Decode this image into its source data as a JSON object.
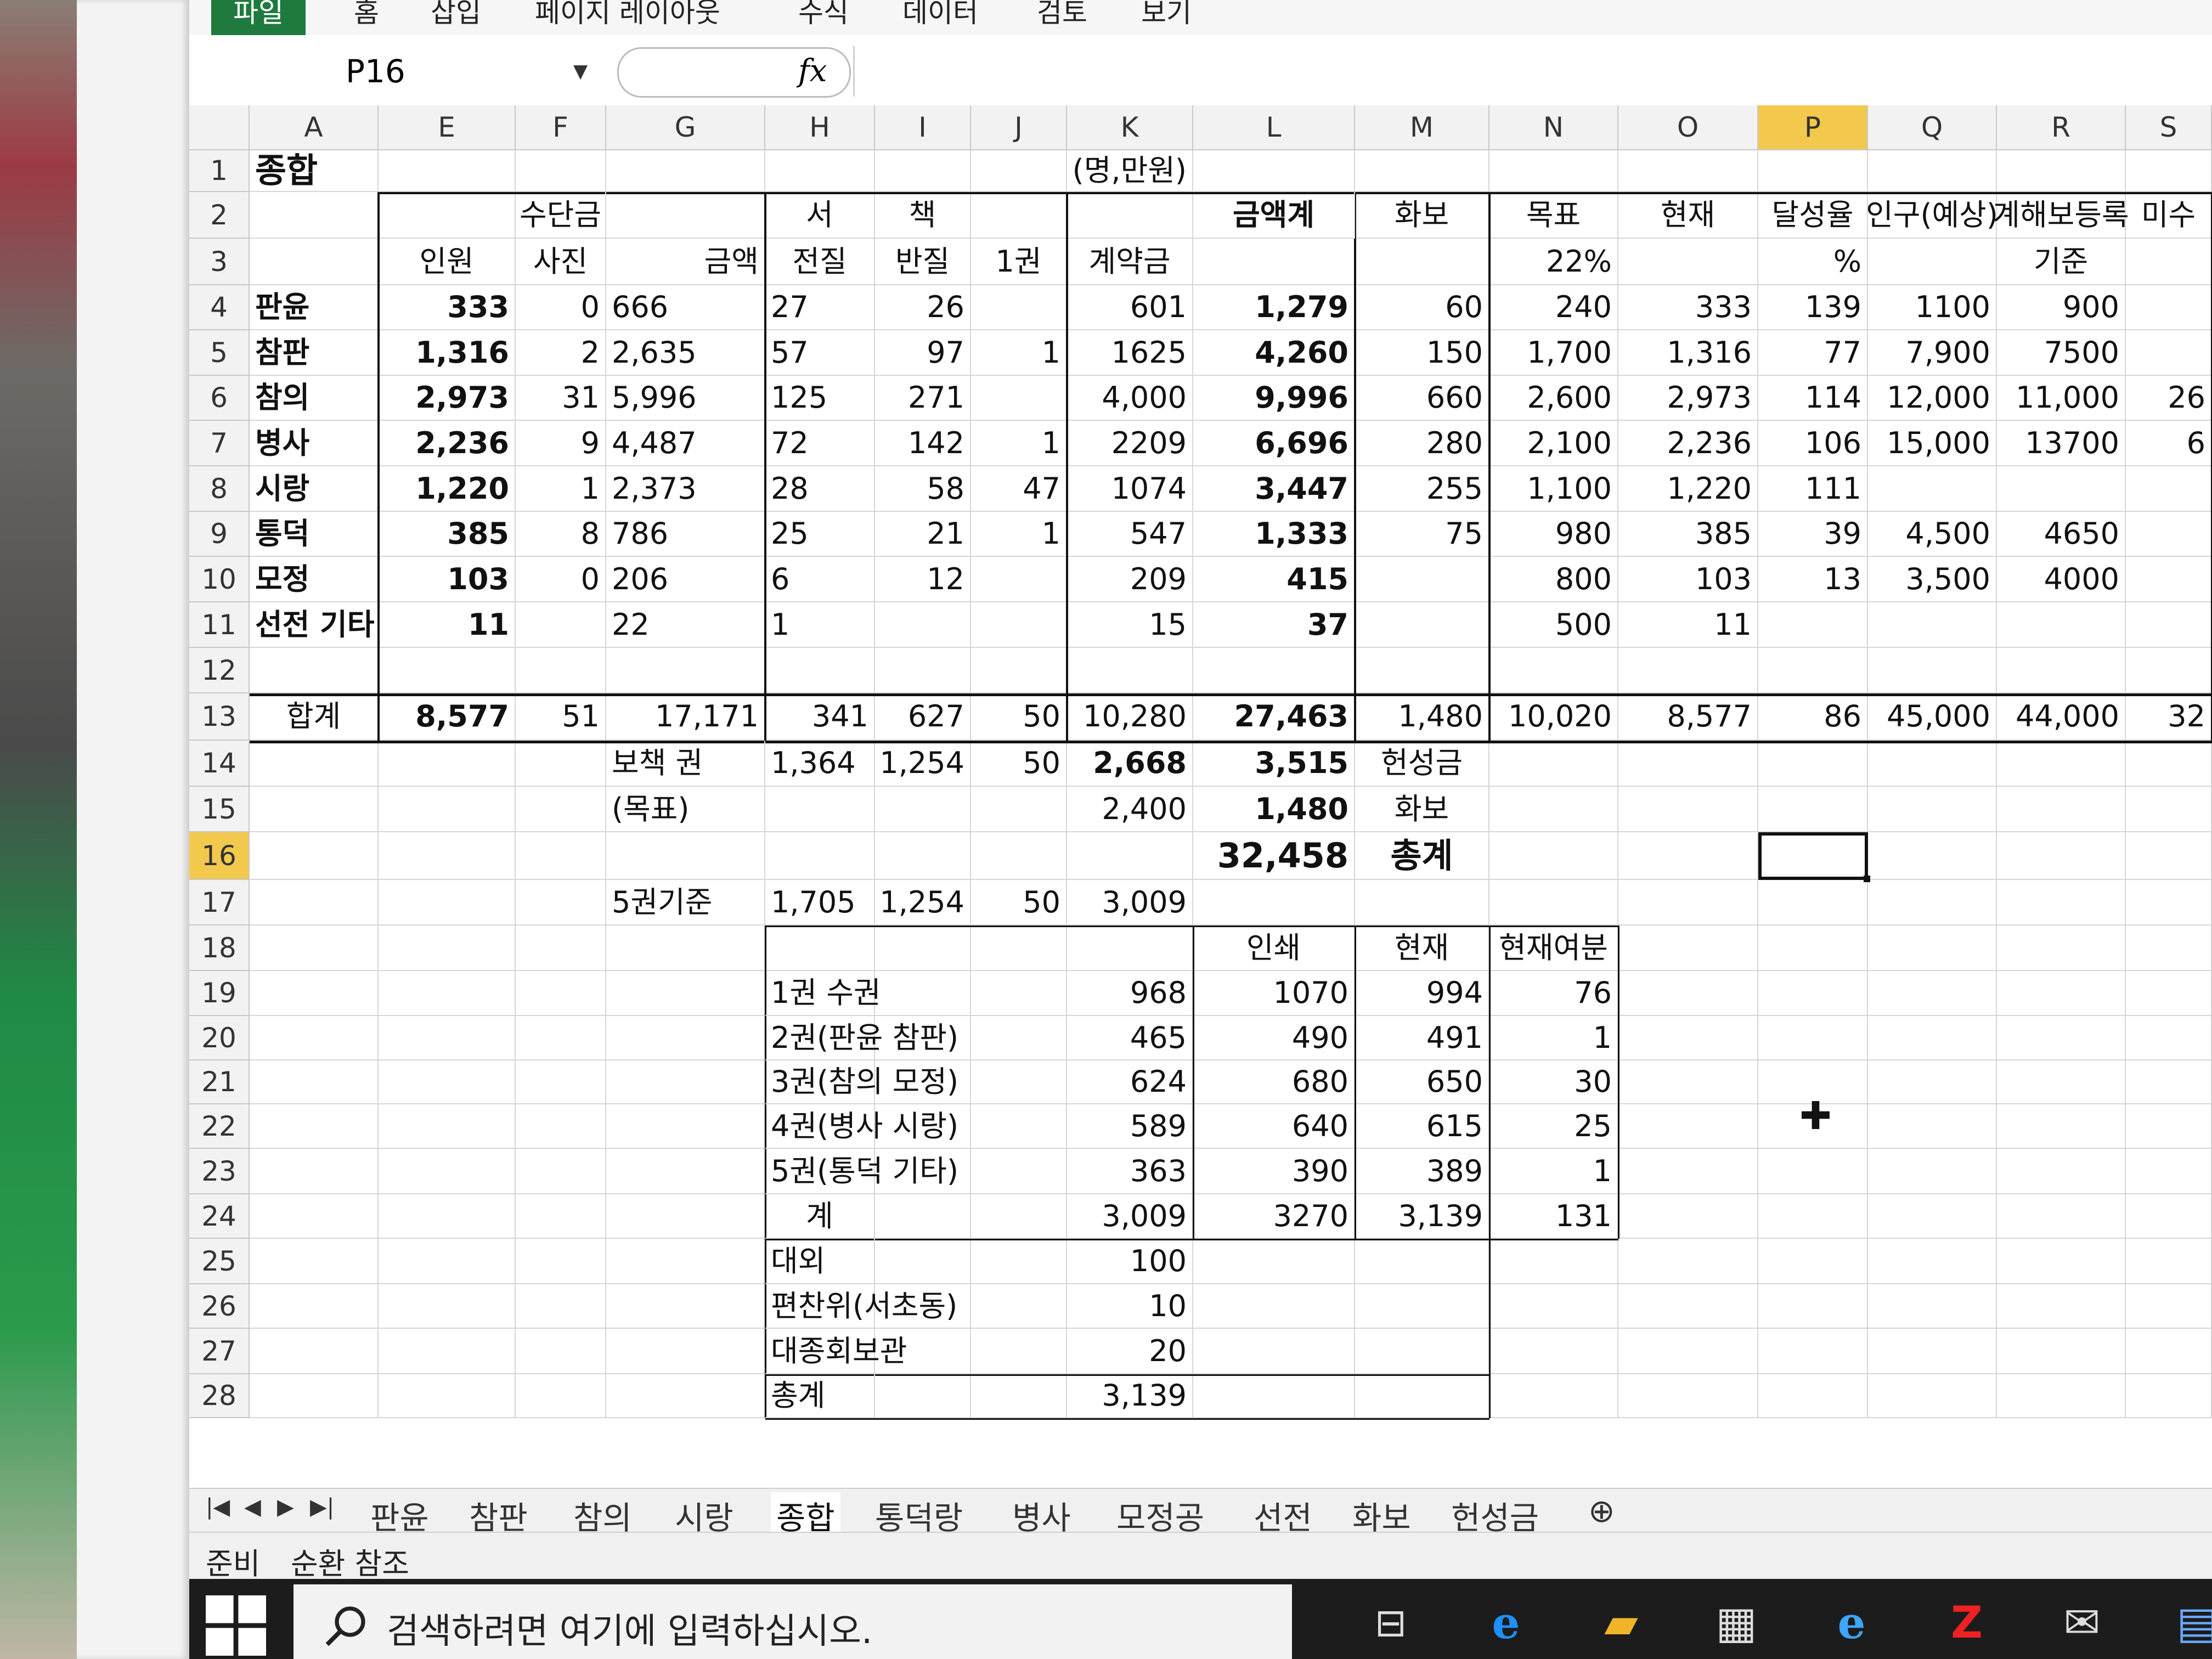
{
  "ribbon": {
    "tabs": [
      "파일",
      "홈",
      "삽입",
      "페이지 레이아웃",
      "수식",
      "데이터",
      "검토",
      "보기"
    ],
    "active": 0
  },
  "formula_bar": {
    "name_box": "P16",
    "fx_label": "fx",
    "formula_value": ""
  },
  "columns": [
    "A",
    "E",
    "F",
    "G",
    "H",
    "I",
    "J",
    "K",
    "L",
    "M",
    "N",
    "O",
    "P",
    "Q",
    "R",
    "S"
  ],
  "selected_column": "P",
  "selected_row": "16",
  "rows": [
    "1",
    "2",
    "3",
    "4",
    "5",
    "6",
    "7",
    "8",
    "9",
    "10",
    "11",
    "12",
    "13",
    "14",
    "15",
    "16",
    "17",
    "18",
    "19",
    "20",
    "21",
    "22",
    "23",
    "24",
    "25",
    "26",
    "27",
    "28"
  ],
  "cells": {
    "r1": {
      "A": "종합",
      "K": "(명,만원)"
    },
    "r2": {
      "F": "수단금",
      "H": "서",
      "I": "책",
      "L": "금액계",
      "M": "화보",
      "N": "목표",
      "O": "현재",
      "P": "달성율",
      "Q": "인구(예상)",
      "R": "계해보등록",
      "S": "미수"
    },
    "r3": {
      "E": "인원",
      "F": "사진",
      "G": "금액",
      "H": "전질",
      "I": "반질",
      "J": "1권",
      "K": "계약금",
      "N": "22%",
      "P": "%",
      "R": "기준"
    },
    "r4": {
      "A": "판윤",
      "E": "333",
      "F": "0",
      "G": "666",
      "H": "27",
      "I": "26",
      "K": "601",
      "L": "1,279",
      "M": "60",
      "N": "240",
      "O": "333",
      "P": "139",
      "Q": "1100",
      "R": "900"
    },
    "r5": {
      "A": "참판",
      "E": "1,316",
      "F": "2",
      "G": "2,635",
      "H": "57",
      "I": "97",
      "J": "1",
      "K": "1625",
      "L": "4,260",
      "M": "150",
      "N": "1,700",
      "O": "1,316",
      "P": "77",
      "Q": "7,900",
      "R": "7500"
    },
    "r6": {
      "A": "참의",
      "E": "2,973",
      "F": "31",
      "G": "5,996",
      "H": "125",
      "I": "271",
      "K": "4,000",
      "L": "9,996",
      "M": "660",
      "N": "2,600",
      "O": "2,973",
      "P": "114",
      "Q": "12,000",
      "R": "11,000",
      "S": "26"
    },
    "r7": {
      "A": "병사",
      "E": "2,236",
      "F": "9",
      "G": "4,487",
      "H": "72",
      "I": "142",
      "J": "1",
      "K": "2209",
      "L": "6,696",
      "M": "280",
      "N": "2,100",
      "O": "2,236",
      "P": "106",
      "Q": "15,000",
      "R": "13700",
      "S": "6"
    },
    "r8": {
      "A": "시랑",
      "E": "1,220",
      "F": "1",
      "G": "2,373",
      "H": "28",
      "I": "58",
      "J": "47",
      "K": "1074",
      "L": "3,447",
      "M": "255",
      "N": "1,100",
      "O": "1,220",
      "P": "111"
    },
    "r9": {
      "A": "통덕",
      "E": "385",
      "F": "8",
      "G": "786",
      "H": "25",
      "I": "21",
      "J": "1",
      "K": "547",
      "L": "1,333",
      "M": "75",
      "N": "980",
      "O": "385",
      "P": "39",
      "Q": "4,500",
      "R": "4650"
    },
    "r10": {
      "A": "모정",
      "E": "103",
      "F": "0",
      "G": "206",
      "H": "6",
      "I": "12",
      "K": "209",
      "L": "415",
      "N": "800",
      "O": "103",
      "P": "13",
      "Q": "3,500",
      "R": "4000"
    },
    "r11": {
      "A": "선전 기타",
      "E": "11",
      "G": "22",
      "H": "1",
      "K": "15",
      "L": "37",
      "N": "500",
      "O": "11"
    },
    "r13": {
      "A": "합계",
      "E": "8,577",
      "F": "51",
      "G": "17,171",
      "H": "341",
      "I": "627",
      "J": "50",
      "K": "10,280",
      "L": "27,463",
      "M": "1,480",
      "N": "10,020",
      "O": "8,577",
      "P": "86",
      "Q": "45,000",
      "R": "44,000",
      "S": "32"
    },
    "r14": {
      "G": "보책 권",
      "H": "1,364",
      "I": "1,254",
      "J": "50",
      "K": "2,668",
      "L": "3,515",
      "M": "헌성금"
    },
    "r15": {
      "G": "(목표)",
      "K": "2,400",
      "L": "1,480",
      "M": "화보"
    },
    "r16": {
      "L": "32,458",
      "M": "총계"
    },
    "r17": {
      "G": "5권기준",
      "H": "1,705",
      "I": "1,254",
      "J": "50",
      "K": "3,009"
    },
    "r18": {
      "L": "인쇄",
      "M": "현재",
      "N": "현재여분"
    },
    "r19": {
      "H": "1권        수권",
      "K": "968",
      "L": "1070",
      "M": "994",
      "N": "76"
    },
    "r20": {
      "H": "2권(판윤 참판)",
      "K": "465",
      "L": "490",
      "M": "491",
      "N": "1"
    },
    "r21": {
      "H": "3권(참의 모정)",
      "K": "624",
      "L": "680",
      "M": "650",
      "N": "30"
    },
    "r22": {
      "H": "4권(병사 시랑)",
      "K": "589",
      "L": "640",
      "M": "615",
      "N": "25"
    },
    "r23": {
      "H": "5권(통덕 기타)",
      "K": "363",
      "L": "390",
      "M": "389",
      "N": "1"
    },
    "r24": {
      "H": "계",
      "K": "3,009",
      "L": "3270",
      "M": "3,139",
      "N": "131"
    },
    "r25": {
      "H": "대외",
      "K": "100"
    },
    "r26": {
      "H": "편찬위(서초동)",
      "K": "10"
    },
    "r27": {
      "H": "대종회보관",
      "K": "20"
    },
    "r28": {
      "H": "총계",
      "K": "3,139"
    }
  },
  "sheet_tabs": [
    "판윤",
    "참판",
    "참의",
    "시랑",
    "종합",
    "통덕랑",
    "병사",
    "모정공",
    "선전",
    "화보",
    "헌성금"
  ],
  "active_sheet": "종합",
  "status": {
    "ready": "준비",
    "circular": "순환 참조"
  },
  "taskbar": {
    "search_placeholder": "검색하려면 여기에 입력하십시오."
  },
  "colors": {
    "file_tab": "#1f7a3e",
    "selected_header": "#f2c94c",
    "taskbar": "#1c1c1c"
  }
}
